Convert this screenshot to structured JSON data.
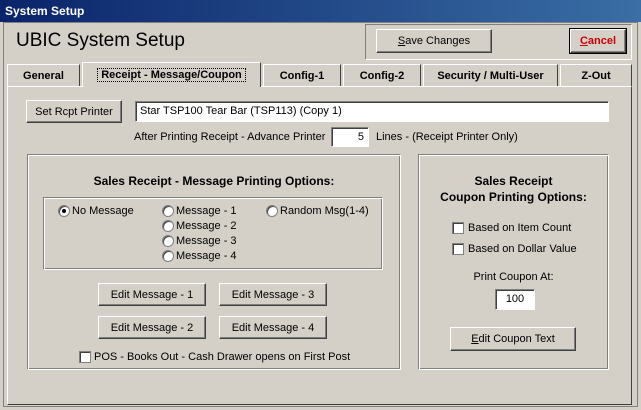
{
  "window": {
    "title": "System Setup"
  },
  "app": {
    "title": "UBIC System Setup"
  },
  "toolbar": {
    "save_prefix": "",
    "save_u": "S",
    "save_rest": "ave Changes",
    "cancel_u": "C",
    "cancel_rest": "ancel"
  },
  "colors": {
    "cancel_text": "#cc0000",
    "titlebar": "#0a246a"
  },
  "tabs": [
    {
      "label": "General"
    },
    {
      "label": "Receipt - Message/Coupon"
    },
    {
      "label": "Config-1"
    },
    {
      "label": "Config-2"
    },
    {
      "label": "Security / Multi-User"
    },
    {
      "label": "Z-Out"
    }
  ],
  "printer": {
    "button_label": "Set Rcpt Printer",
    "value": "Star TSP100 Tear Bar (TSP113) (Copy 1)"
  },
  "advance": {
    "before": "After Printing Receipt - Advance Printer",
    "value": "5",
    "after": "Lines  -  (Receipt Printer Only)"
  },
  "message": {
    "header": "Sales Receipt - Message Printing Options:",
    "options": [
      "No Message",
      "Message - 1",
      "Message - 2",
      "Message - 3",
      "Message - 4",
      "Random Msg(1-4)"
    ],
    "selected": "No Message",
    "edit_buttons": [
      "Edit Message - 1",
      "Edit Message - 3",
      "Edit Message - 2",
      "Edit Message - 4"
    ],
    "books_out_label": "POS - Books Out - Cash Drawer opens on First Post"
  },
  "coupon": {
    "header_line1": "Sales Receipt",
    "header_line2": "Coupon Printing Options:",
    "item_count_label": "Based on Item Count",
    "dollar_value_label": "Based on Dollar Value",
    "print_at_label": "Print Coupon At:",
    "print_at_value": "100",
    "edit_u": "E",
    "edit_rest": "dit Coupon Text"
  }
}
